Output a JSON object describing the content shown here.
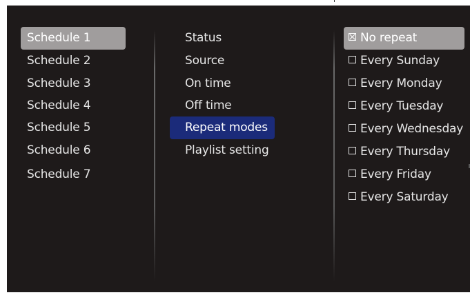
{
  "schedules": {
    "items": [
      {
        "label": "Schedule 1"
      },
      {
        "label": "Schedule 2"
      },
      {
        "label": "Schedule 3"
      },
      {
        "label": "Schedule 4"
      },
      {
        "label": "Schedule 5"
      },
      {
        "label": "Schedule 6"
      },
      {
        "label": "Schedule 7"
      }
    ],
    "selected": "Schedule 1"
  },
  "settings": {
    "items": [
      {
        "label": "Status"
      },
      {
        "label": "Source"
      },
      {
        "label": "On time"
      },
      {
        "label": "Off time"
      },
      {
        "label": "Repeat modes"
      },
      {
        "label": "Playlist setting"
      }
    ],
    "selected": "Repeat modes"
  },
  "repeat_modes": {
    "items": [
      {
        "label": "No repeat",
        "checked": true
      },
      {
        "label": "Every Sunday",
        "checked": false
      },
      {
        "label": "Every Monday",
        "checked": false
      },
      {
        "label": "Every Tuesday",
        "checked": false
      },
      {
        "label": "Every Wednesday",
        "checked": false
      },
      {
        "label": "Every Thursday",
        "checked": false
      },
      {
        "label": "Every Friday",
        "checked": false
      },
      {
        "label": "Every Saturday",
        "checked": false
      }
    ],
    "focused": "No repeat"
  },
  "colors": {
    "background": "#1e1a1a",
    "focus_gray": "#a09d9d",
    "selected_blue": "#1b2b7a",
    "text": "#e6e6e6"
  }
}
